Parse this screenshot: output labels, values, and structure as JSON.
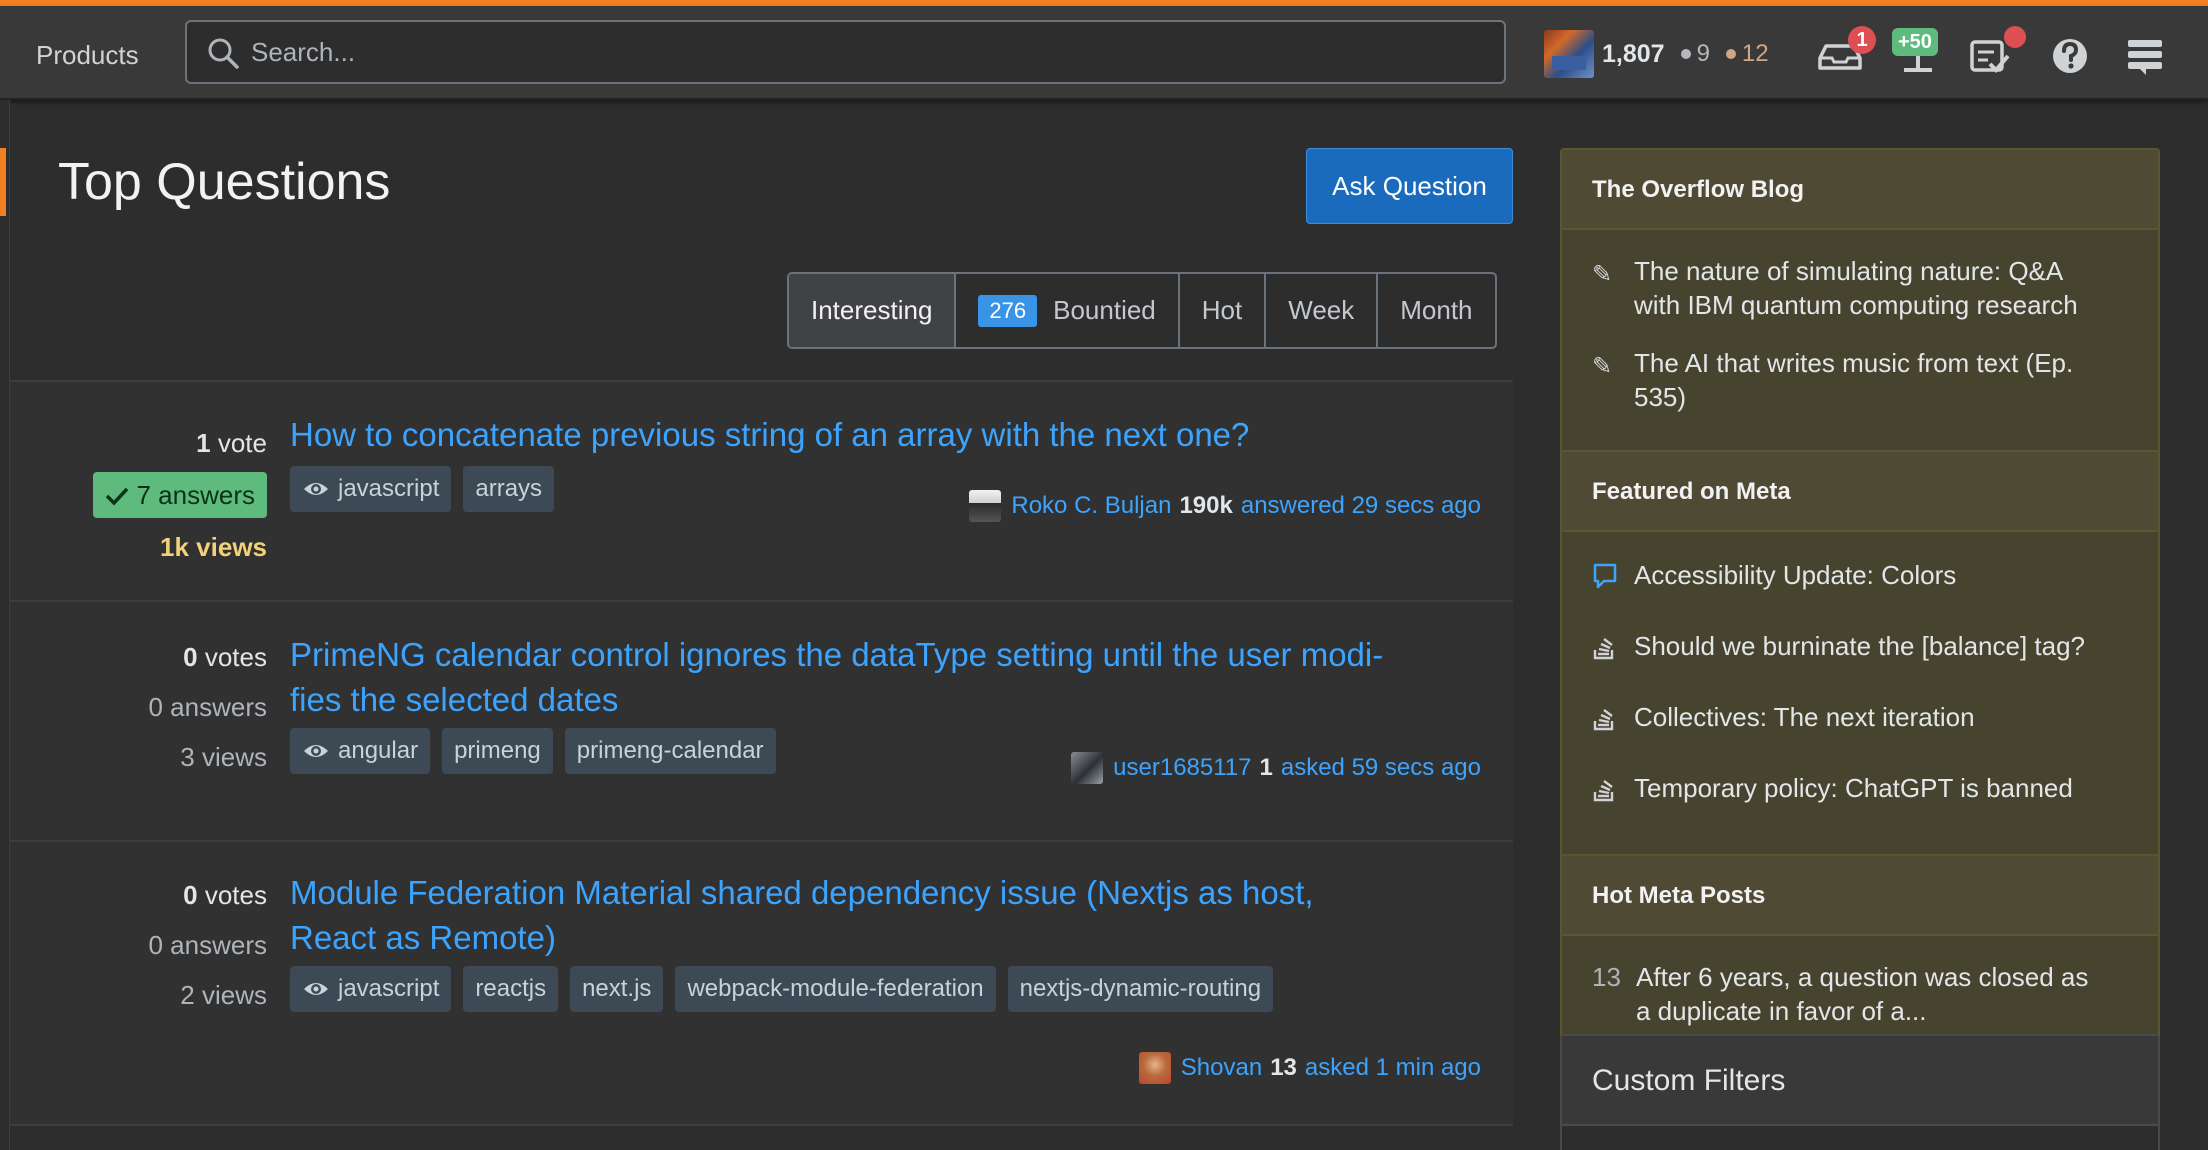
{
  "header": {
    "products_label": "Products",
    "search_placeholder": "Search...",
    "reputation": "1,807",
    "silver_badges": "9",
    "bronze_badges": "12",
    "inbox_count": "1",
    "achievements_count": "+50",
    "colors": {
      "silver": "#b4b8bc",
      "bronze": "#d1a684",
      "accent": "#f48024"
    }
  },
  "main": {
    "title": "Top Questions",
    "ask_button": "Ask Question",
    "tabs": [
      {
        "label": "Interesting",
        "active": true
      },
      {
        "label": "Bountied",
        "badge": "276"
      },
      {
        "label": "Hot"
      },
      {
        "label": "Week"
      },
      {
        "label": "Month"
      }
    ],
    "questions": [
      {
        "votes_n": "1",
        "votes_label": "vote",
        "answers_n": "7",
        "answers_label": "answers",
        "accepted": true,
        "views_n": "1k",
        "views_label": "views",
        "title": "How to concatenate previous string of an array with the next one?",
        "tags": [
          "javascript",
          "arrays"
        ],
        "user": "Roko C. Buljan",
        "user_rep": "190k",
        "action": "answered 29 secs ago"
      },
      {
        "votes_n": "0",
        "votes_label": "votes",
        "answers_n": "0",
        "answers_label": "answers",
        "views_n": "3",
        "views_label": "views",
        "title_line1": "PrimeNG calendar control ignores the dataType setting until the user modi-",
        "title_line2": "fies the selected dates",
        "tags": [
          "angular",
          "primeng",
          "primeng-calendar"
        ],
        "user": "user1685117",
        "user_rep": "1",
        "action": "asked 59 secs ago"
      },
      {
        "votes_n": "0",
        "votes_label": "votes",
        "answers_n": "0",
        "answers_label": "answers",
        "views_n": "2",
        "views_label": "views",
        "title_line1": "Module Federation Material shared dependency issue (Nextjs as host,",
        "title_line2": "React as Remote)",
        "tags": [
          "javascript",
          "reactjs",
          "next.js",
          "webpack-module-federation",
          "nextjs-dynamic-routing"
        ],
        "user": "Shovan",
        "user_rep": "13",
        "action": "asked 1 min ago"
      }
    ]
  },
  "sidebar": {
    "blog_title": "The Overflow Blog",
    "blog_items": [
      {
        "line1": "The nature of simulating nature: Q&A",
        "line2": "with IBM quantum computing research"
      },
      {
        "line1": "The AI that writes music from text (Ep.",
        "line2": "535)"
      }
    ],
    "meta_title": "Featured on Meta",
    "meta_items": [
      "Accessibility Update: Colors",
      "Should we burninate the [balance] tag?",
      "Collectives: The next iteration",
      "Temporary policy: ChatGPT is banned"
    ],
    "hot_title": "Hot Meta Posts",
    "hot_items": [
      {
        "num": "13",
        "line1": "After 6 years, a question was closed as",
        "line2": "a duplicate in favor of a..."
      }
    ],
    "custom_filters": "Custom Filters"
  }
}
